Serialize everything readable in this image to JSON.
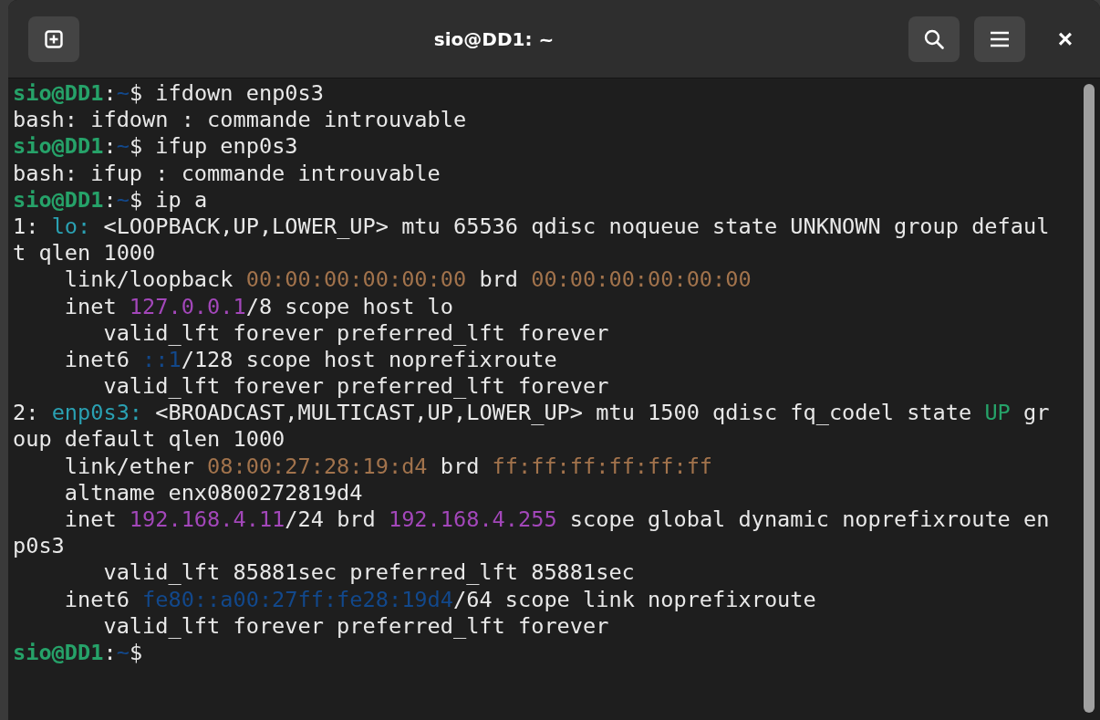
{
  "window": {
    "title": "sio@DD1: ~",
    "close_label": "×"
  },
  "terminal": {
    "lines": [
      [
        {
          "kind": "user",
          "text": "sio@DD1"
        },
        {
          "kind": "plain",
          "text": ":"
        },
        {
          "kind": "path",
          "text": "~"
        },
        {
          "kind": "plain",
          "text": "$ ifdown enp0s3"
        }
      ],
      [
        {
          "kind": "plain",
          "text": "bash: ifdown : commande introuvable"
        }
      ],
      [
        {
          "kind": "user",
          "text": "sio@DD1"
        },
        {
          "kind": "plain",
          "text": ":"
        },
        {
          "kind": "path",
          "text": "~"
        },
        {
          "kind": "plain",
          "text": "$ ifup enp0s3"
        }
      ],
      [
        {
          "kind": "plain",
          "text": "bash: ifup : commande introuvable"
        }
      ],
      [
        {
          "kind": "user",
          "text": "sio@DD1"
        },
        {
          "kind": "plain",
          "text": ":"
        },
        {
          "kind": "path",
          "text": "~"
        },
        {
          "kind": "plain",
          "text": "$ ip a"
        }
      ],
      [
        {
          "kind": "plain",
          "text": "1: "
        },
        {
          "kind": "iface",
          "text": "lo:"
        },
        {
          "kind": "plain",
          "text": " <LOOPBACK,UP,LOWER_UP> mtu 65536 qdisc noqueue state UNKNOWN group defaul"
        }
      ],
      [
        {
          "kind": "plain",
          "text": "t qlen 1000"
        }
      ],
      [
        {
          "kind": "plain",
          "text": "    link/loopback "
        },
        {
          "kind": "mac",
          "text": "00:00:00:00:00:00"
        },
        {
          "kind": "plain",
          "text": " brd "
        },
        {
          "kind": "mac",
          "text": "00:00:00:00:00:00"
        }
      ],
      [
        {
          "kind": "plain",
          "text": "    inet "
        },
        {
          "kind": "ipv4",
          "text": "127.0.0.1"
        },
        {
          "kind": "plain",
          "text": "/8 scope host lo"
        }
      ],
      [
        {
          "kind": "plain",
          "text": "       valid_lft forever preferred_lft forever"
        }
      ],
      [
        {
          "kind": "plain",
          "text": "    inet6 "
        },
        {
          "kind": "ipv6",
          "text": "::1"
        },
        {
          "kind": "plain",
          "text": "/128 scope host noprefixroute"
        }
      ],
      [
        {
          "kind": "plain",
          "text": "       valid_lft forever preferred_lft forever"
        }
      ],
      [
        {
          "kind": "plain",
          "text": "2: "
        },
        {
          "kind": "iface",
          "text": "enp0s3:"
        },
        {
          "kind": "plain",
          "text": " <BROADCAST,MULTICAST,UP,LOWER_UP> mtu 1500 qdisc fq_codel state "
        },
        {
          "kind": "state_up",
          "text": "UP"
        },
        {
          "kind": "plain",
          "text": " gr"
        }
      ],
      [
        {
          "kind": "plain",
          "text": "oup default qlen 1000"
        }
      ],
      [
        {
          "kind": "plain",
          "text": "    link/ether "
        },
        {
          "kind": "mac",
          "text": "08:00:27:28:19:d4"
        },
        {
          "kind": "plain",
          "text": " brd "
        },
        {
          "kind": "mac",
          "text": "ff:ff:ff:ff:ff:ff"
        }
      ],
      [
        {
          "kind": "plain",
          "text": "    altname enx0800272819d4"
        }
      ],
      [
        {
          "kind": "plain",
          "text": "    inet "
        },
        {
          "kind": "ipv4",
          "text": "192.168.4.11"
        },
        {
          "kind": "plain",
          "text": "/24 brd "
        },
        {
          "kind": "ipv4",
          "text": "192.168.4.255"
        },
        {
          "kind": "plain",
          "text": " scope global dynamic noprefixroute en"
        }
      ],
      [
        {
          "kind": "plain",
          "text": "p0s3"
        }
      ],
      [
        {
          "kind": "plain",
          "text": "       valid_lft 85881sec preferred_lft 85881sec"
        }
      ],
      [
        {
          "kind": "plain",
          "text": "    inet6 "
        },
        {
          "kind": "ipv6",
          "text": "fe80::a00:27ff:fe28:19d4"
        },
        {
          "kind": "plain",
          "text": "/64 scope link noprefixroute"
        }
      ],
      [
        {
          "kind": "plain",
          "text": "       valid_lft forever preferred_lft forever"
        }
      ],
      [
        {
          "kind": "user",
          "text": "sio@DD1"
        },
        {
          "kind": "plain",
          "text": ":"
        },
        {
          "kind": "path",
          "text": "~"
        },
        {
          "kind": "plain",
          "text": "$"
        }
      ]
    ]
  }
}
